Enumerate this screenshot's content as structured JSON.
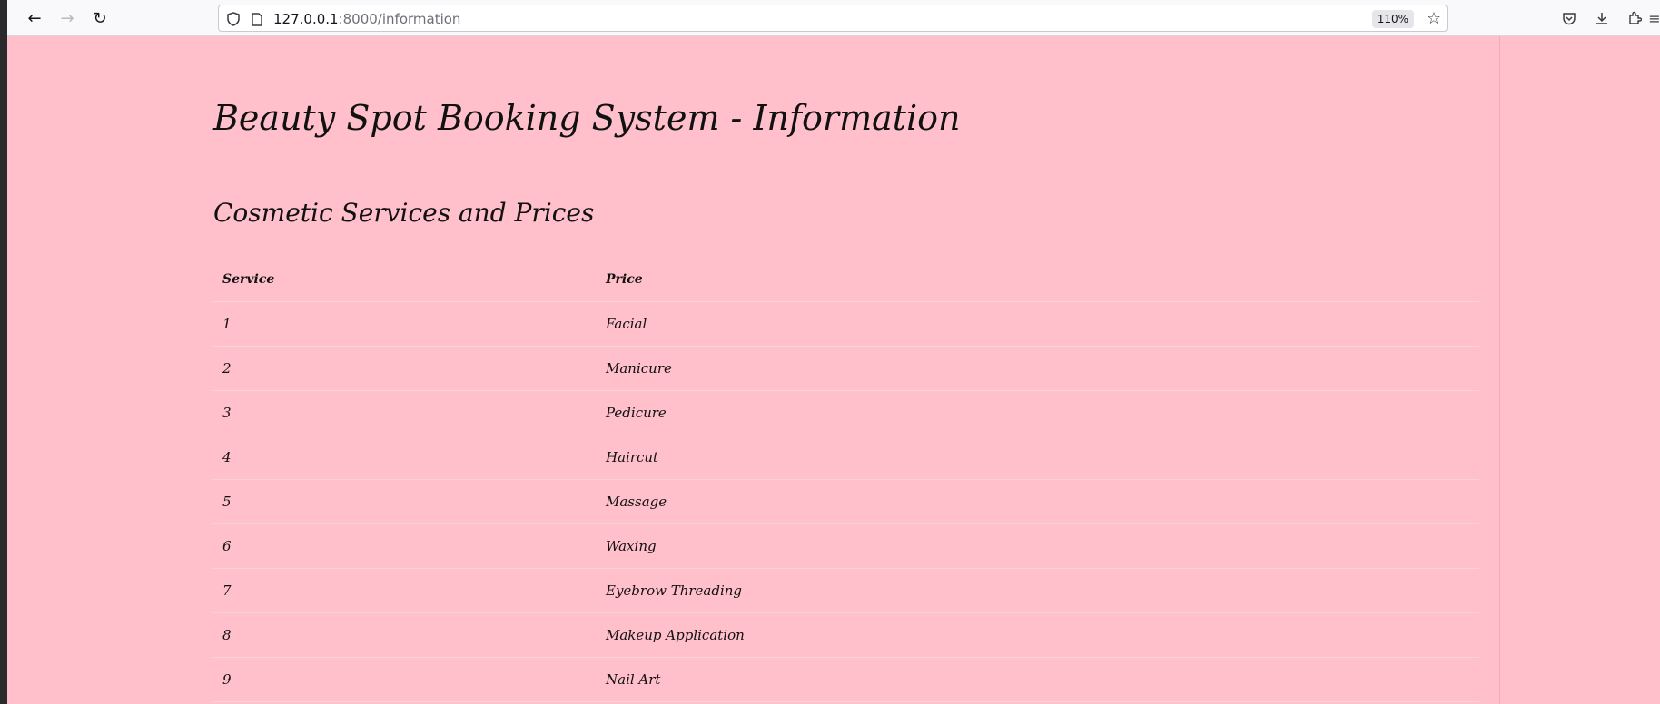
{
  "browser": {
    "url_host": "127.0.0.1",
    "url_rest": ":8000/information",
    "zoom": "110%"
  },
  "page": {
    "title": "Beauty Spot Booking System - Information",
    "section_title": "Cosmetic Services and Prices",
    "table": {
      "headers": [
        "Service",
        "Price"
      ],
      "rows": [
        {
          "service": "1",
          "price": "Facial"
        },
        {
          "service": "2",
          "price": "Manicure"
        },
        {
          "service": "3",
          "price": "Pedicure"
        },
        {
          "service": "4",
          "price": "Haircut"
        },
        {
          "service": "5",
          "price": "Massage"
        },
        {
          "service": "6",
          "price": "Waxing"
        },
        {
          "service": "7",
          "price": "Eyebrow Threading"
        },
        {
          "service": "8",
          "price": "Makeup Application"
        },
        {
          "service": "9",
          "price": "Nail Art"
        }
      ]
    }
  },
  "colors": {
    "page_background": "#ffc0cb",
    "toolbar_background": "#f9f9fb"
  },
  "icons": {
    "back": "arrow-left-icon",
    "forward": "arrow-right-icon",
    "reload": "reload-icon",
    "shield": "shield-icon",
    "page": "page-icon",
    "star": "star-icon",
    "pocket": "pocket-icon",
    "download": "download-icon",
    "extensions": "extensions-icon",
    "menu": "menu-icon"
  }
}
